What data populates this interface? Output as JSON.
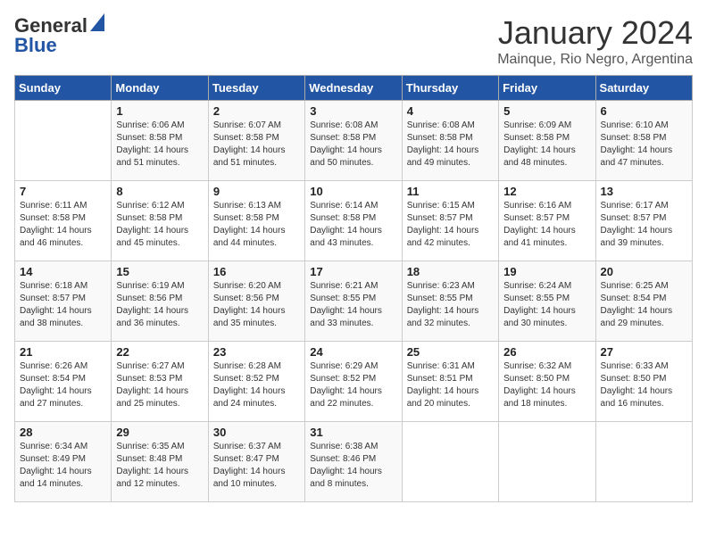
{
  "logo": {
    "general": "General",
    "blue": "Blue"
  },
  "header": {
    "month": "January 2024",
    "location": "Mainque, Rio Negro, Argentina"
  },
  "days_of_week": [
    "Sunday",
    "Monday",
    "Tuesday",
    "Wednesday",
    "Thursday",
    "Friday",
    "Saturday"
  ],
  "weeks": [
    [
      {
        "day": "",
        "sunrise": "",
        "sunset": "",
        "daylight": ""
      },
      {
        "day": "1",
        "sunrise": "Sunrise: 6:06 AM",
        "sunset": "Sunset: 8:58 PM",
        "daylight": "Daylight: 14 hours and 51 minutes."
      },
      {
        "day": "2",
        "sunrise": "Sunrise: 6:07 AM",
        "sunset": "Sunset: 8:58 PM",
        "daylight": "Daylight: 14 hours and 51 minutes."
      },
      {
        "day": "3",
        "sunrise": "Sunrise: 6:08 AM",
        "sunset": "Sunset: 8:58 PM",
        "daylight": "Daylight: 14 hours and 50 minutes."
      },
      {
        "day": "4",
        "sunrise": "Sunrise: 6:08 AM",
        "sunset": "Sunset: 8:58 PM",
        "daylight": "Daylight: 14 hours and 49 minutes."
      },
      {
        "day": "5",
        "sunrise": "Sunrise: 6:09 AM",
        "sunset": "Sunset: 8:58 PM",
        "daylight": "Daylight: 14 hours and 48 minutes."
      },
      {
        "day": "6",
        "sunrise": "Sunrise: 6:10 AM",
        "sunset": "Sunset: 8:58 PM",
        "daylight": "Daylight: 14 hours and 47 minutes."
      }
    ],
    [
      {
        "day": "7",
        "sunrise": "Sunrise: 6:11 AM",
        "sunset": "Sunset: 8:58 PM",
        "daylight": "Daylight: 14 hours and 46 minutes."
      },
      {
        "day": "8",
        "sunrise": "Sunrise: 6:12 AM",
        "sunset": "Sunset: 8:58 PM",
        "daylight": "Daylight: 14 hours and 45 minutes."
      },
      {
        "day": "9",
        "sunrise": "Sunrise: 6:13 AM",
        "sunset": "Sunset: 8:58 PM",
        "daylight": "Daylight: 14 hours and 44 minutes."
      },
      {
        "day": "10",
        "sunrise": "Sunrise: 6:14 AM",
        "sunset": "Sunset: 8:58 PM",
        "daylight": "Daylight: 14 hours and 43 minutes."
      },
      {
        "day": "11",
        "sunrise": "Sunrise: 6:15 AM",
        "sunset": "Sunset: 8:57 PM",
        "daylight": "Daylight: 14 hours and 42 minutes."
      },
      {
        "day": "12",
        "sunrise": "Sunrise: 6:16 AM",
        "sunset": "Sunset: 8:57 PM",
        "daylight": "Daylight: 14 hours and 41 minutes."
      },
      {
        "day": "13",
        "sunrise": "Sunrise: 6:17 AM",
        "sunset": "Sunset: 8:57 PM",
        "daylight": "Daylight: 14 hours and 39 minutes."
      }
    ],
    [
      {
        "day": "14",
        "sunrise": "Sunrise: 6:18 AM",
        "sunset": "Sunset: 8:57 PM",
        "daylight": "Daylight: 14 hours and 38 minutes."
      },
      {
        "day": "15",
        "sunrise": "Sunrise: 6:19 AM",
        "sunset": "Sunset: 8:56 PM",
        "daylight": "Daylight: 14 hours and 36 minutes."
      },
      {
        "day": "16",
        "sunrise": "Sunrise: 6:20 AM",
        "sunset": "Sunset: 8:56 PM",
        "daylight": "Daylight: 14 hours and 35 minutes."
      },
      {
        "day": "17",
        "sunrise": "Sunrise: 6:21 AM",
        "sunset": "Sunset: 8:55 PM",
        "daylight": "Daylight: 14 hours and 33 minutes."
      },
      {
        "day": "18",
        "sunrise": "Sunrise: 6:23 AM",
        "sunset": "Sunset: 8:55 PM",
        "daylight": "Daylight: 14 hours and 32 minutes."
      },
      {
        "day": "19",
        "sunrise": "Sunrise: 6:24 AM",
        "sunset": "Sunset: 8:55 PM",
        "daylight": "Daylight: 14 hours and 30 minutes."
      },
      {
        "day": "20",
        "sunrise": "Sunrise: 6:25 AM",
        "sunset": "Sunset: 8:54 PM",
        "daylight": "Daylight: 14 hours and 29 minutes."
      }
    ],
    [
      {
        "day": "21",
        "sunrise": "Sunrise: 6:26 AM",
        "sunset": "Sunset: 8:54 PM",
        "daylight": "Daylight: 14 hours and 27 minutes."
      },
      {
        "day": "22",
        "sunrise": "Sunrise: 6:27 AM",
        "sunset": "Sunset: 8:53 PM",
        "daylight": "Daylight: 14 hours and 25 minutes."
      },
      {
        "day": "23",
        "sunrise": "Sunrise: 6:28 AM",
        "sunset": "Sunset: 8:52 PM",
        "daylight": "Daylight: 14 hours and 24 minutes."
      },
      {
        "day": "24",
        "sunrise": "Sunrise: 6:29 AM",
        "sunset": "Sunset: 8:52 PM",
        "daylight": "Daylight: 14 hours and 22 minutes."
      },
      {
        "day": "25",
        "sunrise": "Sunrise: 6:31 AM",
        "sunset": "Sunset: 8:51 PM",
        "daylight": "Daylight: 14 hours and 20 minutes."
      },
      {
        "day": "26",
        "sunrise": "Sunrise: 6:32 AM",
        "sunset": "Sunset: 8:50 PM",
        "daylight": "Daylight: 14 hours and 18 minutes."
      },
      {
        "day": "27",
        "sunrise": "Sunrise: 6:33 AM",
        "sunset": "Sunset: 8:50 PM",
        "daylight": "Daylight: 14 hours and 16 minutes."
      }
    ],
    [
      {
        "day": "28",
        "sunrise": "Sunrise: 6:34 AM",
        "sunset": "Sunset: 8:49 PM",
        "daylight": "Daylight: 14 hours and 14 minutes."
      },
      {
        "day": "29",
        "sunrise": "Sunrise: 6:35 AM",
        "sunset": "Sunset: 8:48 PM",
        "daylight": "Daylight: 14 hours and 12 minutes."
      },
      {
        "day": "30",
        "sunrise": "Sunrise: 6:37 AM",
        "sunset": "Sunset: 8:47 PM",
        "daylight": "Daylight: 14 hours and 10 minutes."
      },
      {
        "day": "31",
        "sunrise": "Sunrise: 6:38 AM",
        "sunset": "Sunset: 8:46 PM",
        "daylight": "Daylight: 14 hours and 8 minutes."
      },
      {
        "day": "",
        "sunrise": "",
        "sunset": "",
        "daylight": ""
      },
      {
        "day": "",
        "sunrise": "",
        "sunset": "",
        "daylight": ""
      },
      {
        "day": "",
        "sunrise": "",
        "sunset": "",
        "daylight": ""
      }
    ]
  ]
}
